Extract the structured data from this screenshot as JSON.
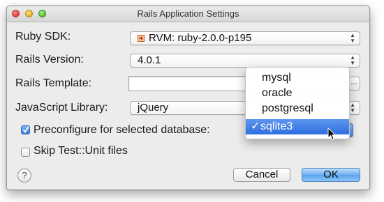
{
  "window": {
    "title": "Rails Application Settings"
  },
  "form": {
    "ruby_sdk": {
      "label": "Ruby SDK:",
      "value": "RVM: ruby-2.0.0-p195",
      "icon": "rvm-icon"
    },
    "rails_version": {
      "label": "Rails Version:",
      "value": "4.0.1"
    },
    "rails_template": {
      "label": "Rails Template:",
      "value": ""
    },
    "javascript_library": {
      "label": "JavaScript Library:",
      "value": "jQuery"
    },
    "preconfigure": {
      "label": "Preconfigure for selected database:",
      "checked": true
    },
    "skip_tests": {
      "label": "Skip Test::Unit files",
      "checked": false
    }
  },
  "database_menu": {
    "options": [
      "mysql",
      "oracle",
      "postgresql",
      "sqlite3"
    ],
    "selected": "sqlite3",
    "tick": "✓"
  },
  "buttons": {
    "help": "?",
    "browse": "...",
    "cancel": "Cancel",
    "ok": "OK"
  },
  "colors": {
    "accent": "#3574e0",
    "window_bg": "#ececec"
  }
}
